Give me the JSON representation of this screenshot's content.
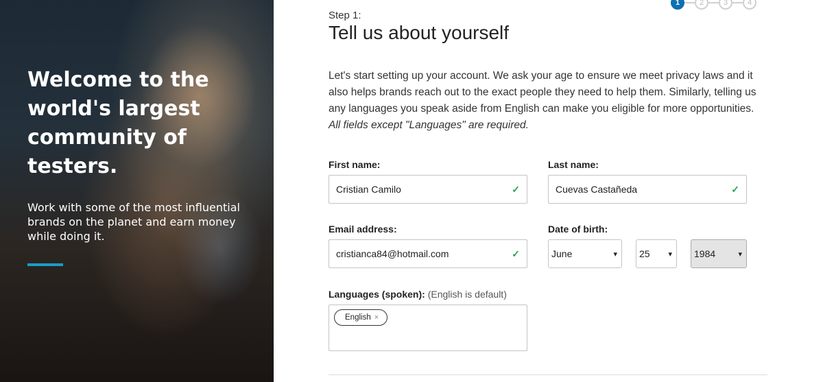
{
  "hero": {
    "title": "Welcome to the world's largest community of testers.",
    "subtitle": "Work with some of the most influential brands on the planet and earn money while doing it.",
    "accent_color": "#1a9dc8"
  },
  "stepper": {
    "steps": [
      "1",
      "2",
      "3",
      "4"
    ],
    "current": 1,
    "active_color": "#0f6fb0"
  },
  "form": {
    "step_label": "Step 1:",
    "title": "Tell us about yourself",
    "intro": "Let's start setting up your account. We ask your age to ensure we meet privacy laws and it also helps brands reach out to the exact people they need to help them. Similarly, telling us any languages you speak aside from English can make you eligible for more opportunities. ",
    "intro_required": "All fields except \"Languages\" are required.",
    "first_name": {
      "label": "First name:",
      "value": "Cristian Camilo",
      "valid": true
    },
    "last_name": {
      "label": "Last name:",
      "value": "Cuevas Castañeda",
      "valid": true
    },
    "email": {
      "label": "Email address:",
      "value": "cristianca84@hotmail.com",
      "valid": true
    },
    "dob": {
      "label": "Date of birth:",
      "month": "June",
      "day": "25",
      "year": "1984"
    },
    "languages": {
      "label": "Languages (spoken):",
      "hint": "(English is default)",
      "chips": [
        "English"
      ]
    },
    "valid_color": "#27a05a"
  }
}
